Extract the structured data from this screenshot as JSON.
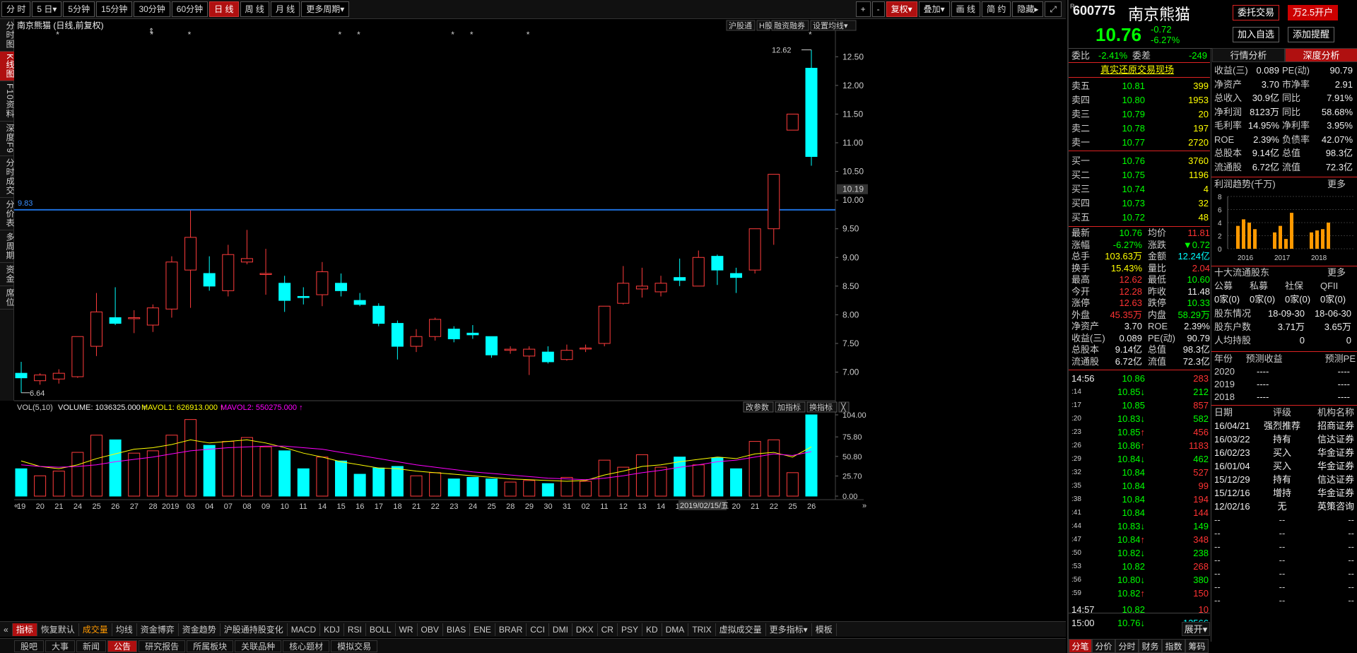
{
  "toolbar": {
    "left": [
      {
        "id": "fs",
        "label": "分 时"
      },
      {
        "id": "5d",
        "label": "5 日▾"
      },
      {
        "id": "5m",
        "label": "5分钟"
      },
      {
        "id": "15m",
        "label": "15分钟"
      },
      {
        "id": "30m",
        "label": "30分钟"
      },
      {
        "id": "60m",
        "label": "60分钟"
      },
      {
        "id": "day",
        "label": "日 线",
        "active": true
      },
      {
        "id": "week",
        "label": "周 线"
      },
      {
        "id": "month",
        "label": "月 线"
      },
      {
        "id": "more",
        "label": "更多周期▾"
      }
    ],
    "right": [
      {
        "id": "plus",
        "label": "+"
      },
      {
        "id": "minus",
        "label": "-"
      },
      {
        "id": "fq",
        "label": "复权▾",
        "active": true
      },
      {
        "id": "overlay",
        "label": "叠加▾"
      },
      {
        "id": "draw",
        "label": "画 线"
      },
      {
        "id": "simple",
        "label": "简 约"
      },
      {
        "id": "hide",
        "label": "隐藏▸"
      },
      {
        "id": "full",
        "label": "⤢"
      }
    ]
  },
  "leftnav": [
    "分时图",
    "K线图",
    "F10资料",
    "深度F9",
    "分时成交",
    "分价表",
    "多周期",
    "资金",
    "席位"
  ],
  "chart": {
    "title": "南京熊猫 (日线,前复权)",
    "tags": [
      "沪股通",
      "H股",
      "融资融券",
      "设置均线▾"
    ],
    "hline_label": "9.83",
    "current_price_label": "10.19",
    "max_label": "12.62",
    "min_label": "6.64",
    "vol_legend": {
      "name": "VOL(5,10)",
      "volume": "VOLUME: 1036325.000 ↑",
      "mavol1": "MAVOL1: 626913.000 ↑",
      "mavol2": "MAVOL2: 550275.000 ↑"
    },
    "vol_buttons": [
      "改参数",
      "加指标",
      "换指标",
      "╳"
    ],
    "date_tooltip": "2019/02/15/五"
  },
  "chart_data": {
    "type": "candlestick",
    "price_axis": {
      "ticks": [
        7.0,
        7.5,
        8.0,
        8.5,
        9.0,
        9.5,
        10.0,
        10.5,
        11.0,
        11.5,
        12.0,
        12.5
      ]
    },
    "vol_axis": {
      "ticks": [
        "104.00",
        "75.80",
        "50.80",
        "25.70",
        "0.00"
      ],
      "max": 104
    },
    "x_labels": [
      "19",
      "20",
      "21",
      "24",
      "25",
      "26",
      "27",
      "28",
      "2019",
      "03",
      "04",
      "07",
      "08",
      "09",
      "10",
      "11",
      "14",
      "15",
      "16",
      "17",
      "18",
      "21",
      "22",
      "23",
      "24",
      "25",
      "28",
      "29",
      "30",
      "31",
      "02",
      "11",
      "12",
      "13",
      "14",
      "15",
      "18",
      "19",
      "20",
      "21",
      "22",
      "25",
      "26"
    ],
    "candles": [
      {
        "o": 6.98,
        "h": 7.18,
        "l": 6.64,
        "c": 6.9
      },
      {
        "o": 6.85,
        "h": 6.98,
        "l": 6.78,
        "c": 6.95
      },
      {
        "o": 6.88,
        "h": 7.05,
        "l": 6.8,
        "c": 6.98
      },
      {
        "o": 6.92,
        "h": 7.62,
        "l": 6.9,
        "c": 7.62
      },
      {
        "o": 7.45,
        "h": 8.38,
        "l": 7.28,
        "c": 8.05
      },
      {
        "o": 7.95,
        "h": 8.48,
        "l": 7.82,
        "c": 7.85
      },
      {
        "o": 7.95,
        "h": 8.08,
        "l": 7.68,
        "c": 7.95
      },
      {
        "o": 7.82,
        "h": 8.18,
        "l": 7.7,
        "c": 8.12
      },
      {
        "o": 8.1,
        "h": 9.02,
        "l": 7.95,
        "c": 8.92
      },
      {
        "o": 8.78,
        "h": 9.82,
        "l": 8.12,
        "c": 9.35
      },
      {
        "o": 8.72,
        "h": 9.02,
        "l": 8.42,
        "c": 8.5
      },
      {
        "o": 8.42,
        "h": 9.22,
        "l": 8.32,
        "c": 9.05
      },
      {
        "o": 8.92,
        "h": 9.48,
        "l": 8.88,
        "c": 8.98
      },
      {
        "o": 8.72,
        "h": 9.15,
        "l": 8.35,
        "c": 8.72
      },
      {
        "o": 8.55,
        "h": 8.68,
        "l": 8.05,
        "c": 8.25
      },
      {
        "o": 8.32,
        "h": 8.48,
        "l": 8.18,
        "c": 8.3
      },
      {
        "o": 8.35,
        "h": 8.92,
        "l": 8.15,
        "c": 8.75
      },
      {
        "o": 8.55,
        "h": 8.72,
        "l": 8.32,
        "c": 8.42
      },
      {
        "o": 8.25,
        "h": 8.38,
        "l": 8.15,
        "c": 8.18
      },
      {
        "o": 8.15,
        "h": 8.2,
        "l": 7.8,
        "c": 7.85
      },
      {
        "o": 7.85,
        "h": 7.9,
        "l": 7.22,
        "c": 7.45
      },
      {
        "o": 7.45,
        "h": 7.75,
        "l": 7.35,
        "c": 7.62
      },
      {
        "o": 7.62,
        "h": 7.95,
        "l": 7.55,
        "c": 7.92
      },
      {
        "o": 7.75,
        "h": 7.8,
        "l": 7.52,
        "c": 7.58
      },
      {
        "o": 7.68,
        "h": 7.82,
        "l": 7.58,
        "c": 7.65
      },
      {
        "o": 7.62,
        "h": 7.62,
        "l": 7.25,
        "c": 7.3
      },
      {
        "o": 7.38,
        "h": 7.45,
        "l": 7.32,
        "c": 7.4
      },
      {
        "o": 7.28,
        "h": 7.45,
        "l": 6.95,
        "c": 7.4
      },
      {
        "o": 7.35,
        "h": 7.45,
        "l": 7.15,
        "c": 7.18
      },
      {
        "o": 7.22,
        "h": 7.48,
        "l": 7.2,
        "c": 7.38
      },
      {
        "o": 7.42,
        "h": 7.48,
        "l": 7.35,
        "c": 7.42
      },
      {
        "o": 7.5,
        "h": 8.15,
        "l": 7.45,
        "c": 8.15
      },
      {
        "o": 8.2,
        "h": 8.85,
        "l": 8.18,
        "c": 8.55
      },
      {
        "o": 8.45,
        "h": 8.82,
        "l": 8.3,
        "c": 8.5
      },
      {
        "o": 8.4,
        "h": 8.68,
        "l": 8.32,
        "c": 8.55
      },
      {
        "o": 8.65,
        "h": 8.98,
        "l": 8.5,
        "c": 8.6
      },
      {
        "o": 8.5,
        "h": 9.12,
        "l": 8.5,
        "c": 9.0
      },
      {
        "o": 9.02,
        "h": 9.05,
        "l": 8.52,
        "c": 8.78
      },
      {
        "o": 8.72,
        "h": 8.82,
        "l": 8.38,
        "c": 8.65
      },
      {
        "o": 8.78,
        "h": 9.5,
        "l": 8.72,
        "c": 9.5
      },
      {
        "o": 9.5,
        "h": 10.45,
        "l": 9.22,
        "c": 10.45
      },
      {
        "o": 11.22,
        "h": 11.5,
        "l": 11.22,
        "c": 11.5
      },
      {
        "o": 12.3,
        "h": 12.62,
        "l": 10.6,
        "c": 10.76
      }
    ],
    "volumes": [
      35,
      26,
      32,
      56,
      78,
      72,
      55,
      58,
      78,
      98,
      65,
      70,
      75,
      63,
      58,
      35,
      50,
      45,
      28,
      36,
      38,
      26,
      30,
      22,
      24,
      22,
      18,
      20,
      16,
      24,
      19,
      46,
      37,
      53,
      37,
      50,
      40,
      49,
      35,
      70,
      72,
      30,
      104
    ],
    "mavol1": [
      45,
      38,
      35,
      40,
      48,
      54,
      60,
      62,
      66,
      72,
      68,
      70,
      72,
      68,
      62,
      55,
      50,
      44,
      40,
      36,
      35,
      32,
      30,
      28,
      26,
      24,
      22,
      21,
      20,
      19,
      20,
      27,
      32,
      38,
      40,
      44,
      47,
      50,
      48,
      54,
      56,
      50,
      63
    ],
    "mavol2": [
      40,
      38,
      37,
      38,
      40,
      44,
      47,
      50,
      54,
      58,
      60,
      62,
      63,
      64,
      64,
      62,
      60,
      56,
      52,
      48,
      44,
      40,
      37,
      34,
      31,
      29,
      27,
      25,
      23,
      22,
      21,
      23,
      26,
      30,
      33,
      37,
      40,
      44,
      46,
      50,
      54,
      52,
      57
    ],
    "hline": 9.83,
    "star_indices": [
      2,
      7,
      9,
      17,
      18,
      23,
      24,
      27,
      42
    ],
    "ma": [
      7.12,
      7.1,
      7.08,
      7.12,
      7.25,
      7.42,
      7.58,
      7.75,
      7.98,
      8.22,
      8.38,
      8.52,
      8.62,
      8.7,
      8.72,
      8.72,
      8.7,
      8.64,
      8.55,
      8.42,
      8.28,
      8.12,
      7.98,
      7.86,
      7.78,
      7.68,
      7.58,
      7.5,
      7.42,
      7.38,
      7.36,
      7.45,
      7.58,
      7.72,
      7.88,
      8.02,
      8.2,
      8.38,
      8.52,
      8.7,
      8.95,
      9.3,
      9.7
    ]
  },
  "bottom_tabs": [
    "指标",
    "恢复默认",
    "成交量",
    "均线",
    "资金博弈",
    "资金趋势",
    "沪股通持股变化",
    "MACD",
    "KDJ",
    "RSI",
    "BOLL",
    "WR",
    "OBV",
    "BIAS",
    "ENE",
    "BRAR",
    "CCI",
    "DMI",
    "DKX",
    "CR",
    "PSY",
    "KD",
    "DMA",
    "TRIX",
    "虚拟成交量",
    "更多指标▾",
    "模板"
  ],
  "taskbar": [
    "股吧",
    "大事",
    "新闻",
    "公告",
    "研究报告",
    "所属板块",
    "关联品种",
    "核心题材",
    "模拟交易"
  ],
  "panel": {
    "code": "600775",
    "name": "南京熊猫",
    "price": "10.76",
    "change": "-0.72",
    "change_pct": "-6.27%",
    "buttons": [
      "委托交易",
      "万2.5开户",
      "加入自选",
      "添加提醒"
    ],
    "weibi_label": "委比",
    "weibi": "-2.41%",
    "weicha_label": "委差",
    "weicha": "-249",
    "link": "真实还原交易现场",
    "sells": [
      {
        "label": "卖五",
        "price": "10.81",
        "vol": "399"
      },
      {
        "label": "卖四",
        "price": "10.80",
        "vol": "1953"
      },
      {
        "label": "卖三",
        "price": "10.79",
        "vol": "20"
      },
      {
        "label": "卖二",
        "price": "10.78",
        "vol": "197"
      },
      {
        "label": "卖一",
        "price": "10.77",
        "vol": "2720"
      }
    ],
    "buys": [
      {
        "label": "买一",
        "price": "10.76",
        "vol": "3760"
      },
      {
        "label": "买二",
        "price": "10.75",
        "vol": "1196"
      },
      {
        "label": "买三",
        "price": "10.74",
        "vol": "4"
      },
      {
        "label": "买四",
        "price": "10.73",
        "vol": "32"
      },
      {
        "label": "买五",
        "price": "10.72",
        "vol": "48"
      }
    ],
    "stats": [
      [
        "最新",
        "10.76",
        "dn",
        "均价",
        "11.81",
        "up"
      ],
      [
        "涨幅",
        "-6.27%",
        "dn",
        "涨跌",
        "▼0.72",
        "dn"
      ],
      [
        "总手",
        "103.63万",
        "yl",
        "金额",
        "12.24亿",
        "cy"
      ],
      [
        "换手",
        "15.43%",
        "yl",
        "量比",
        "2.04",
        "up"
      ],
      [
        "最高",
        "12.62",
        "up",
        "最低",
        "10.60",
        "dn"
      ],
      [
        "今开",
        "12.28",
        "up",
        "昨收",
        "11.48",
        "wt"
      ],
      [
        "涨停",
        "12.63",
        "up",
        "跌停",
        "10.33",
        "dn"
      ],
      [
        "外盘",
        "45.35万",
        "up",
        "内盘",
        "58.29万",
        "dn"
      ],
      [
        "净资产",
        "3.70",
        "wt",
        "ROE",
        "2.39%",
        "wt"
      ],
      [
        "收益(三)",
        "0.089",
        "wt",
        "PE(动)",
        "90.79",
        "wt"
      ],
      [
        "总股本",
        "9.14亿",
        "wt",
        "总值",
        "98.3亿",
        "wt"
      ],
      [
        "流通股",
        "6.72亿",
        "wt",
        "流值",
        "72.3亿",
        "wt"
      ]
    ],
    "ticks": [
      {
        "t": "14:56",
        "p": "10.86",
        "a": "",
        "v": "283",
        "vc": "up"
      },
      {
        "t": ":14",
        "p": "10.85",
        "a": "↓",
        "v": "212",
        "vc": "dn"
      },
      {
        "t": ":17",
        "p": "10.85",
        "a": "",
        "v": "857",
        "vc": "up"
      },
      {
        "t": ":20",
        "p": "10.83",
        "a": "↓",
        "v": "582",
        "vc": "dn"
      },
      {
        "t": ":23",
        "p": "10.85",
        "a": "↑",
        "v": "456",
        "vc": "up"
      },
      {
        "t": ":26",
        "p": "10.86",
        "a": "↑",
        "v": "1183",
        "vc": "up"
      },
      {
        "t": ":29",
        "p": "10.84",
        "a": "↓",
        "v": "462",
        "vc": "dn"
      },
      {
        "t": ":32",
        "p": "10.84",
        "a": "",
        "v": "527",
        "vc": "up"
      },
      {
        "t": ":35",
        "p": "10.84",
        "a": "",
        "v": "99",
        "vc": "up"
      },
      {
        "t": ":38",
        "p": "10.84",
        "a": "",
        "v": "194",
        "vc": "up"
      },
      {
        "t": ":41",
        "p": "10.84",
        "a": "",
        "v": "144",
        "vc": "up"
      },
      {
        "t": ":44",
        "p": "10.83",
        "a": "↓",
        "v": "149",
        "vc": "dn"
      },
      {
        "t": ":47",
        "p": "10.84",
        "a": "↑",
        "v": "348",
        "vc": "up"
      },
      {
        "t": ":50",
        "p": "10.82",
        "a": "↓",
        "v": "238",
        "vc": "dn"
      },
      {
        "t": ":53",
        "p": "10.82",
        "a": "",
        "v": "268",
        "vc": "up"
      },
      {
        "t": ":56",
        "p": "10.80",
        "a": "↓",
        "v": "380",
        "vc": "dn"
      },
      {
        "t": ":59",
        "p": "10.82",
        "a": "↑",
        "v": "150",
        "vc": "up"
      },
      {
        "t": "14:57",
        "p": "10.82",
        "a": "",
        "v": "10",
        "vc": "up"
      },
      {
        "t": "15:00",
        "p": "10.76",
        "a": "↓",
        "v": "12566",
        "vc": "cy"
      }
    ],
    "deep_tabs": [
      "行情分析",
      "深度分析"
    ],
    "fin": [
      [
        "收益(三)",
        "0.089",
        "PE(动)",
        "90.79"
      ],
      [
        "净资产",
        "3.70",
        "市净率",
        "2.91"
      ],
      [
        "总收入",
        "30.9亿",
        "同比",
        "7.91%"
      ],
      [
        "净利润",
        "8123万",
        "同比",
        "58.68%"
      ],
      [
        "毛利率",
        "14.95%",
        "净利率",
        "3.95%"
      ],
      [
        "ROE",
        "2.39%",
        "负债率",
        "42.07%"
      ],
      [
        "总股本",
        "9.14亿",
        "总值",
        "98.3亿"
      ],
      [
        "流通股",
        "6.72亿",
        "流值",
        "72.3亿"
      ]
    ],
    "profit_title": "利润趋势(千万)",
    "more": "更多",
    "profit_chart": {
      "yticks": [
        "8",
        "6",
        "4",
        "2",
        "0"
      ],
      "years": [
        "2016",
        "2017",
        "2018"
      ],
      "groups": [
        [
          3.5,
          4.5,
          4.0,
          3.0
        ],
        [
          2.5,
          3.5,
          1.5,
          5.5
        ],
        [
          2.5,
          2.8,
          3.0,
          4.0
        ]
      ]
    },
    "holders_title": "十大流通股东",
    "holders_header": [
      "公募",
      "私募",
      "社保",
      "QFII"
    ],
    "holders_vals": [
      "0家(0)",
      "0家(0)",
      "0家(0)",
      "0家(0)"
    ],
    "holders_info": [
      [
        "股东情况",
        "18-09-30",
        "18-06-30"
      ],
      [
        "股东户数",
        "3.71万",
        "3.65万"
      ],
      [
        "人均持股",
        "0",
        "0"
      ]
    ],
    "forecast_header": [
      "年份",
      "预测收益",
      "预测PE"
    ],
    "forecast": [
      [
        "2020",
        "----",
        "----"
      ],
      [
        "2019",
        "----",
        "----"
      ],
      [
        "2018",
        "----",
        "----"
      ]
    ],
    "rating_header": [
      "日期",
      "评级",
      "机构名称"
    ],
    "ratings": [
      [
        "16/04/21",
        "强烈推荐",
        "招商证券"
      ],
      [
        "16/03/22",
        "持有",
        "信达证券"
      ],
      [
        "16/02/23",
        "买入",
        "华金证券"
      ],
      [
        "16/01/04",
        "买入",
        "华金证券"
      ],
      [
        "15/12/29",
        "持有",
        "信达证券"
      ],
      [
        "15/12/16",
        "增持",
        "华金证券"
      ],
      [
        "12/02/16",
        "无",
        "英策咨询"
      ]
    ],
    "ratings_empty": 7,
    "bottom_tabs": [
      "分笔",
      "分价",
      "分时",
      "财务",
      "指数",
      "筹码"
    ],
    "expand": "展开▾"
  }
}
